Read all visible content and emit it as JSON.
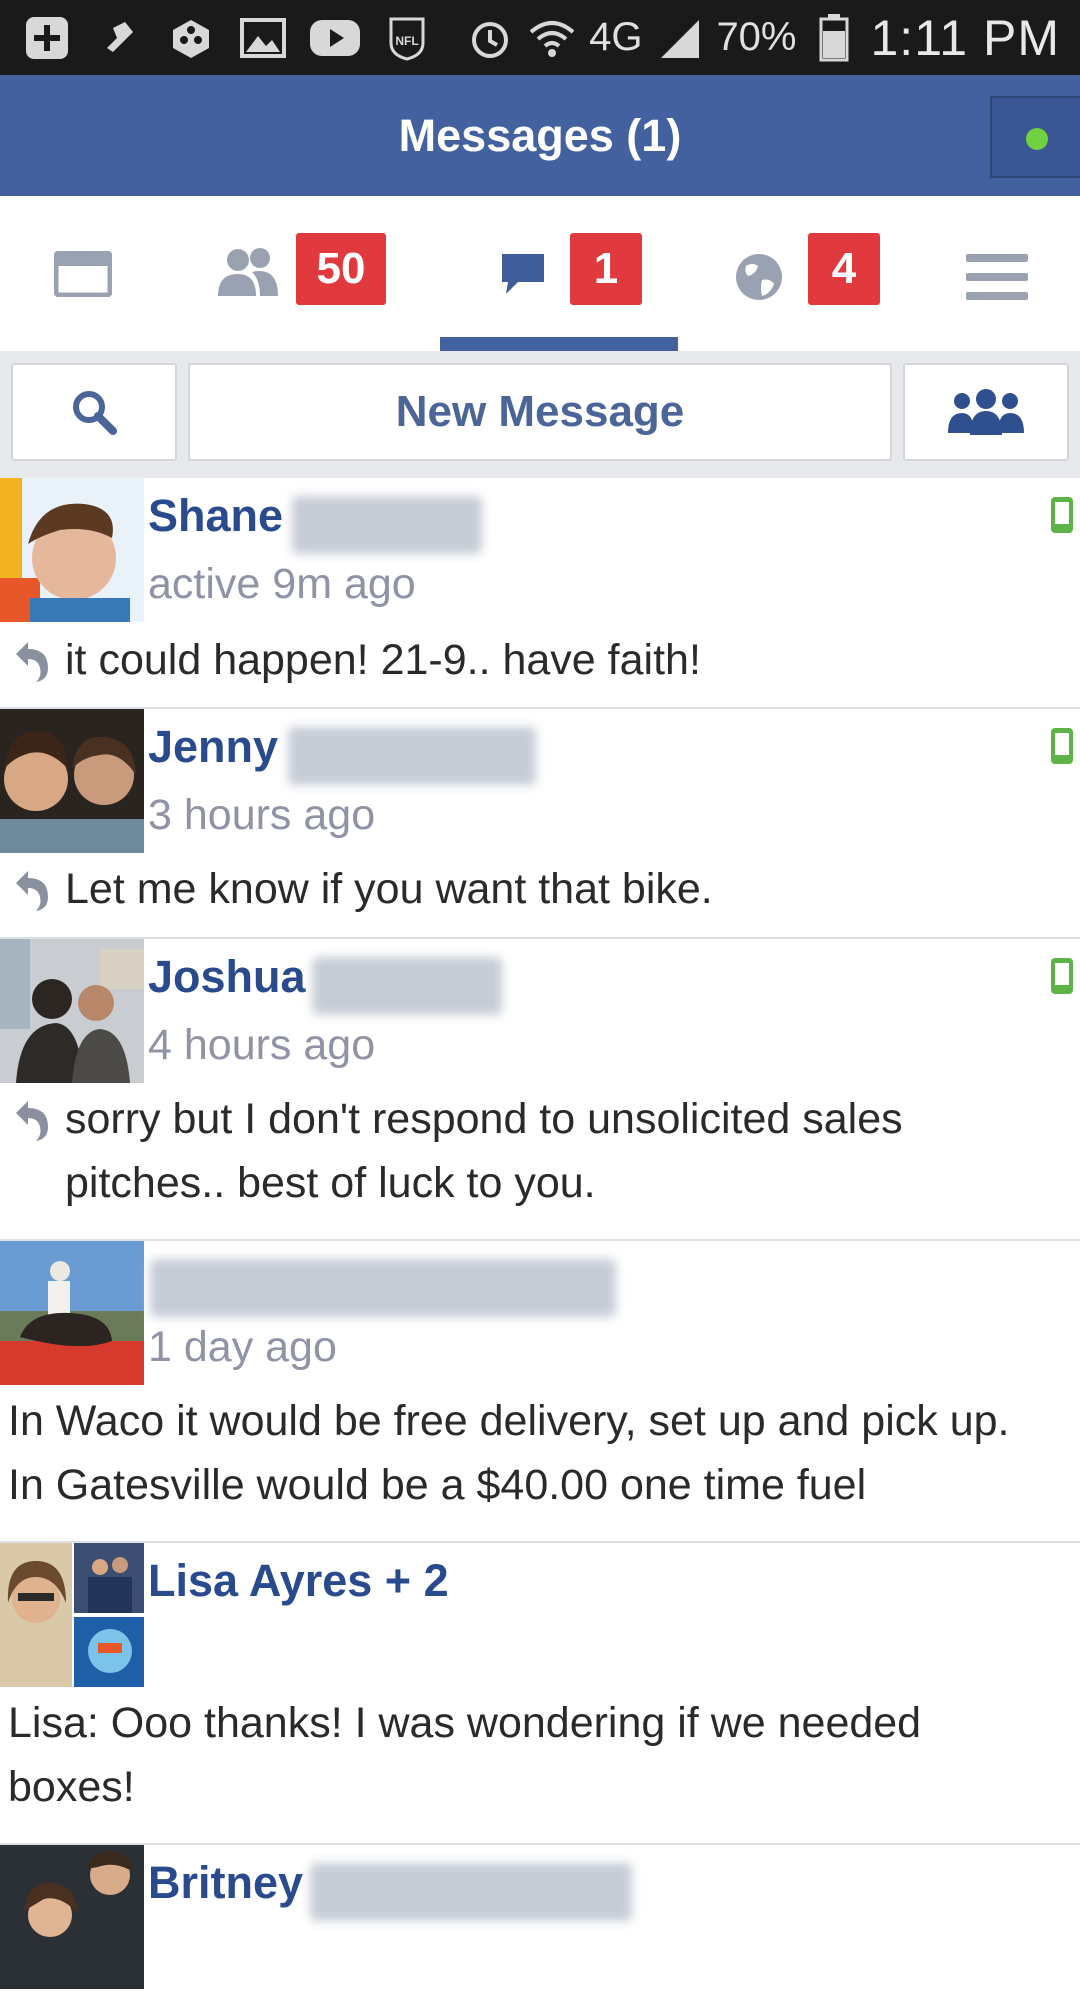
{
  "status_bar": {
    "icons": [
      "plus-icon",
      "pin-icon",
      "dropbox-icon",
      "image-icon",
      "youtube-icon",
      "nfl-icon"
    ],
    "right_icons": [
      "alarm-icon",
      "wifi-icon"
    ],
    "network": "4G",
    "battery_percent": "70%",
    "battery_level": 0.7,
    "clock": "1:11 PM"
  },
  "header": {
    "title": "Messages (1)",
    "chat_status_color": "#72d141"
  },
  "tabs": [
    {
      "name": "news-feed",
      "icon": "news-feed-icon",
      "badge": ""
    },
    {
      "name": "friend-requests",
      "icon": "friends-icon",
      "badge": "50"
    },
    {
      "name": "messages",
      "icon": "chat-bubble-icon",
      "badge": "1",
      "active": true
    },
    {
      "name": "notifications",
      "icon": "globe-icon",
      "badge": "4"
    },
    {
      "name": "more",
      "icon": "menu-icon",
      "badge": ""
    }
  ],
  "actions": {
    "search_icon": "search-icon",
    "new_message_label": "New Message",
    "group_icon": "group-icon"
  },
  "threads": [
    {
      "name": "Shane",
      "time": "active 9m ago",
      "snippet": "it could happen! 21-9.. have faith!",
      "replied": true,
      "mobile": true
    },
    {
      "name": "Jenny",
      "time": "3 hours ago",
      "snippet": "Let me know if you want that bike.",
      "replied": true,
      "mobile": true
    },
    {
      "name": "Joshua",
      "time": "4 hours ago",
      "snippet": "sorry but I don't respond to unsolicited sales pitches.. best of luck to you.",
      "replied": true,
      "mobile": true
    },
    {
      "name": "",
      "time": "1 day ago",
      "snippet": "In Waco it would be free delivery, set up and pick up. In Gatesville would be a $40.00 one time fuel",
      "replied": false,
      "mobile": false
    },
    {
      "name": "Lisa Ayres + 2",
      "time": "",
      "snippet": "Lisa: Ooo thanks! I was wondering if we needed boxes!",
      "replied": false,
      "mobile": false
    },
    {
      "name": "Britney",
      "time": "",
      "snippet": "",
      "replied": false,
      "mobile": false
    }
  ],
  "colors": {
    "brand_blue": "#43619f",
    "badge_red": "#e0393e",
    "name_blue": "#294b8e",
    "mobile_green": "#5eb346"
  }
}
